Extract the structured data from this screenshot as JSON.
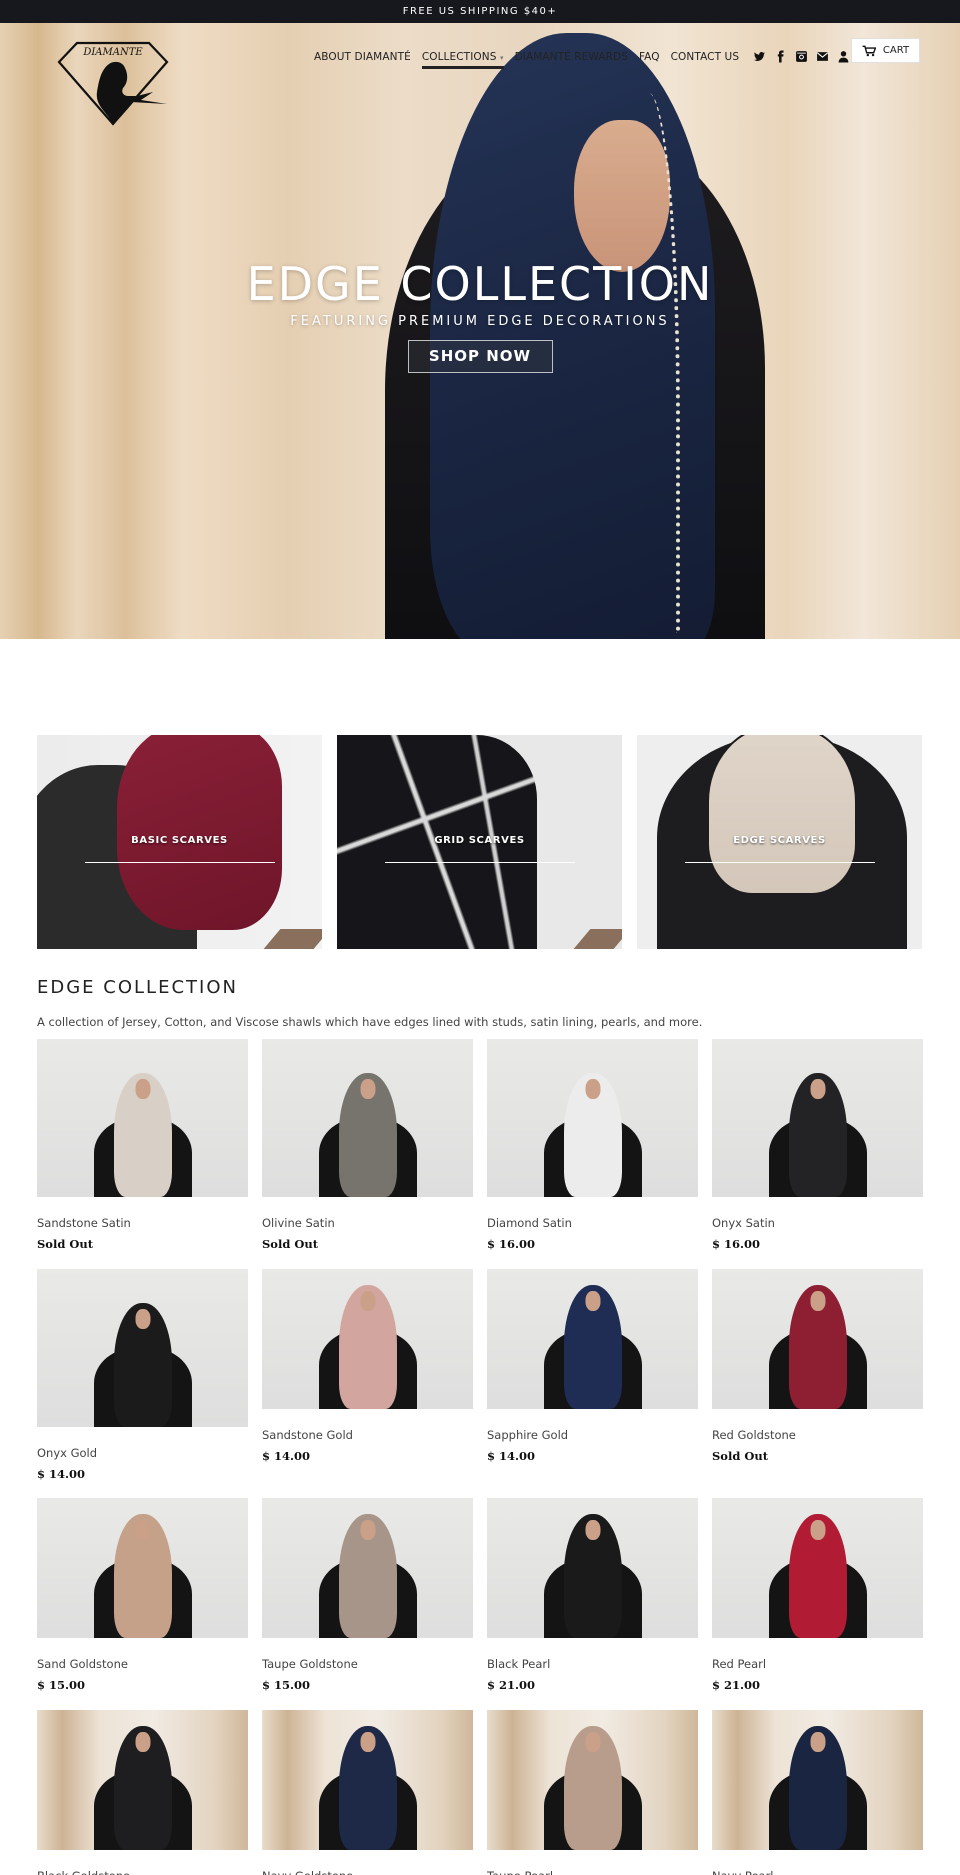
{
  "announcement": "FREE US SHIPPING $40+",
  "brand": {
    "logo_text": "DIAMANTE"
  },
  "nav": {
    "items": [
      "ABOUT DIAMANTÉ",
      "COLLECTIONS",
      "DIAMANTÉ REWARDS",
      "FAQ",
      "CONTACT US"
    ],
    "collections_caret": "▾",
    "icons": [
      "twitter-icon",
      "facebook-icon",
      "instagram-icon",
      "email-icon",
      "account-icon",
      "search-icon"
    ],
    "cart_label": "CART"
  },
  "hero": {
    "title": "EDGE COLLECTION",
    "subtitle": "FEATURING PREMIUM EDGE DECORATIONS",
    "cta": "SHOP NOW"
  },
  "categories": [
    {
      "label": "BASIC SCARVES",
      "color": "#7a1b33"
    },
    {
      "label": "GRID SCARVES",
      "color": "#1c1c20"
    },
    {
      "label": "EDGE SCARVES",
      "color": "#ddd2c6"
    }
  ],
  "collection": {
    "title": "EDGE COLLECTION",
    "description": "A collection of Jersey, Cotton, and Viscose shawls which have edges lined with studs, satin lining, pearls, and more.",
    "products": [
      {
        "name": "Sandstone Satin",
        "price": "Sold Out",
        "color": "#d8cfc6"
      },
      {
        "name": "Olivine Satin",
        "price": "Sold Out",
        "color": "#77746d"
      },
      {
        "name": "Diamond Satin",
        "price": "$ 16.00",
        "color": "#ececec"
      },
      {
        "name": "Onyx Satin",
        "price": "$ 16.00",
        "color": "#232325"
      },
      {
        "name": "Onyx Gold",
        "price": "$ 14.00",
        "color": "#1c1b1c"
      },
      {
        "name": "Sandstone Gold",
        "price": "$ 14.00",
        "color": "#d2a59e"
      },
      {
        "name": "Sapphire Gold",
        "price": "$ 14.00",
        "color": "#1f2d55"
      },
      {
        "name": "Red Goldstone",
        "price": "Sold Out",
        "color": "#8e1f33"
      },
      {
        "name": "Sand Goldstone",
        "price": "$ 15.00",
        "color": "#c4a188"
      },
      {
        "name": "Taupe Goldstone",
        "price": "$ 15.00",
        "color": "#a8958a"
      },
      {
        "name": "Black Pearl",
        "price": "$ 21.00",
        "color": "#1a1a1b"
      },
      {
        "name": "Red Pearl",
        "price": "$ 21.00",
        "color": "#b11b33"
      },
      {
        "name": "Black Goldstone",
        "price": "",
        "color": "#1e1e20"
      },
      {
        "name": "Navy Goldstone",
        "price": "",
        "color": "#1d2947"
      },
      {
        "name": "Taupe Pearl",
        "price": "",
        "color": "#b89d8c"
      },
      {
        "name": "Navy Pearl",
        "price": "",
        "color": "#1a2542"
      }
    ]
  }
}
